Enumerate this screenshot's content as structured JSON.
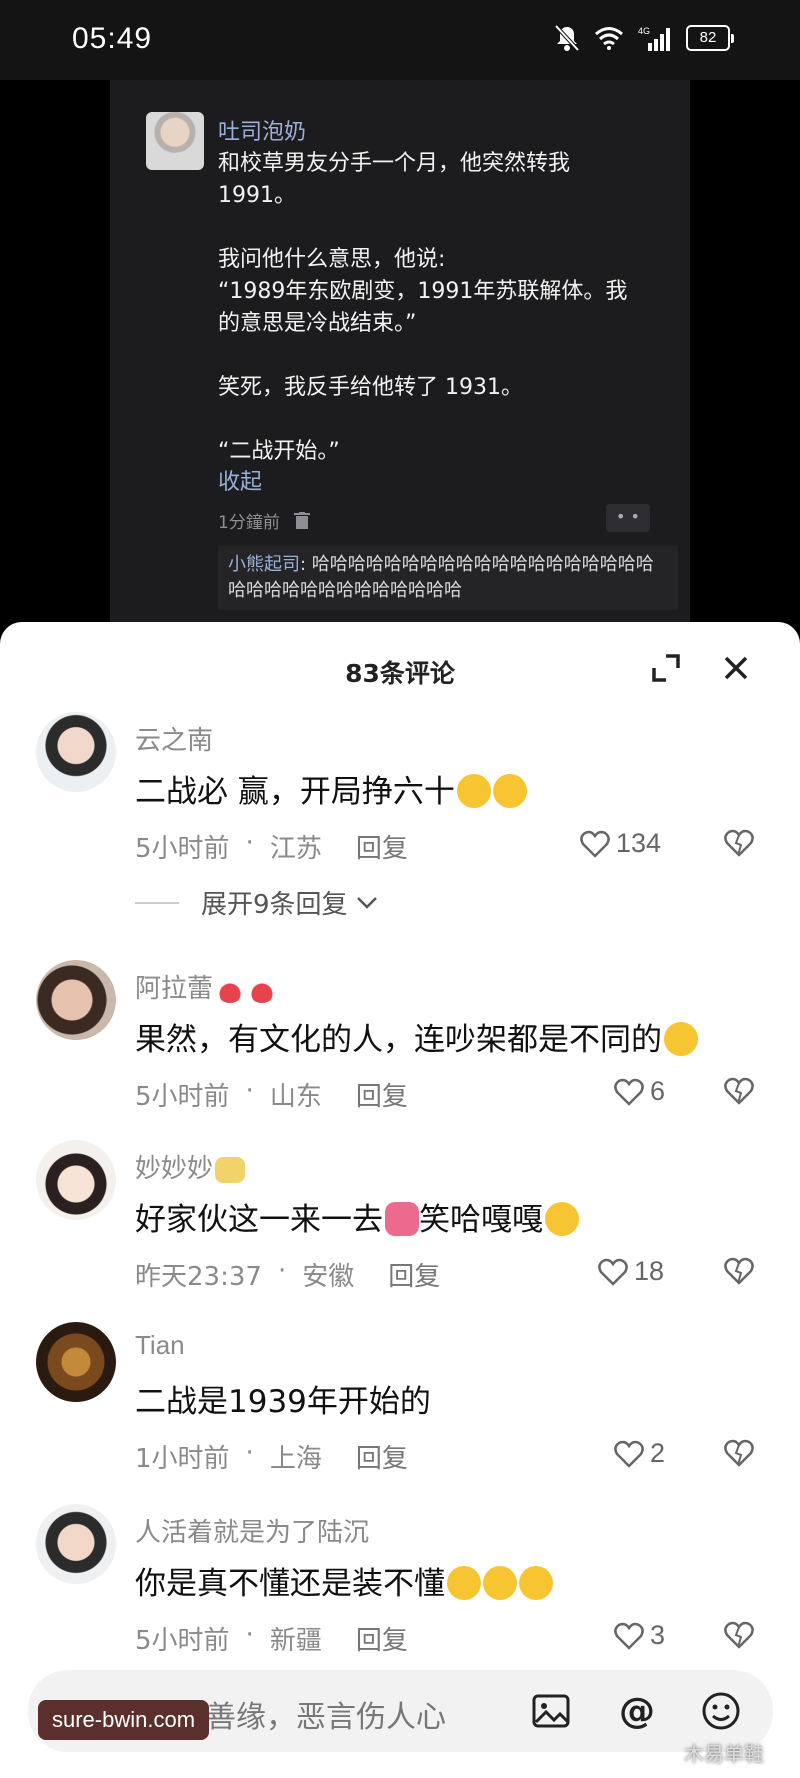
{
  "status_bar": {
    "time": "05:49",
    "battery": "82"
  },
  "post": {
    "username": "吐司泡奶",
    "text": "和校草男友分手一个月，他突然转我\n1991。\n\n我问他什么意思，他说:\n“1989年东欧剧变，1991年苏联解体。我\n的意思是冷战结束。”\n\n笑死，我反手给他转了 1931。\n\n“二战开始。”",
    "collapse": "收起",
    "time": "1分鐘前",
    "reply_user": "小熊起司",
    "reply_text": ": 哈哈哈哈哈哈哈哈哈哈哈哈哈哈哈哈哈哈哈哈哈哈哈哈哈哈哈哈哈哈哈哈"
  },
  "sheet": {
    "title": "83条评论"
  },
  "comments": [
    {
      "name": "云之南",
      "text": "二战必 赢，开局挣六十",
      "time": "5小时前",
      "location": "江苏",
      "reply": "回复",
      "likes": "134"
    },
    {
      "name": "阿拉蕾",
      "text": "果然，有文化的人，连吵架都是不同的",
      "time": "5小时前",
      "location": "山东",
      "reply": "回复",
      "likes": "6"
    },
    {
      "name": "妙妙妙",
      "text_a": "好家伙这一来一去",
      "text_b": "笑哈嘎嘎",
      "time": "昨天23:37",
      "location": "安徽",
      "reply": "回复",
      "likes": "18"
    },
    {
      "name": "Tian",
      "text": "二战是1939年开始的",
      "time": "1小时前",
      "location": "上海",
      "reply": "回复",
      "likes": "2"
    },
    {
      "name": "人活着就是为了陆沉",
      "text": "你是真不懂还是装不懂",
      "time": "5小时前",
      "location": "新疆",
      "reply": "回复",
      "likes": "3"
    }
  ],
  "expand_replies": "展开9条回复",
  "input": {
    "placeholder": "善语结善缘，恶言伤人心"
  },
  "watermark": "sure-bwin.com",
  "watermark2": "木易单鞋"
}
